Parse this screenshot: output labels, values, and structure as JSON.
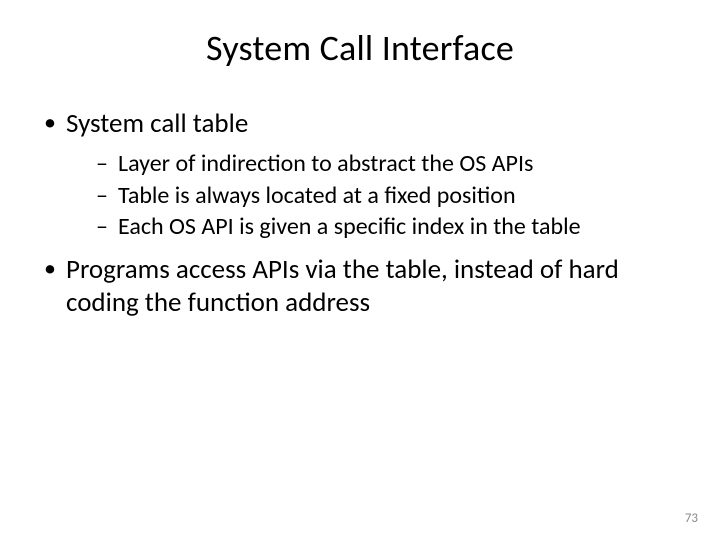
{
  "slide": {
    "title": "System Call Interface",
    "bullets": [
      {
        "text": "System call table",
        "sub": [
          "Layer of indirection to abstract the OS APIs",
          "Table is always located at a fixed position",
          "Each OS API is given a specific index in the table"
        ]
      },
      {
        "text": "Programs access APIs via the table, instead of hard coding the function address",
        "sub": []
      }
    ],
    "page_number": "73"
  }
}
